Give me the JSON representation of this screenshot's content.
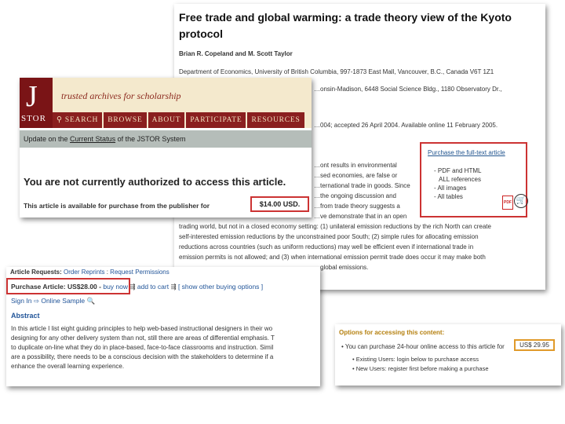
{
  "paper": {
    "title": "Free trade and global warming: a trade theory view of the Kyoto protocol",
    "authors": "Brian R. Copeland and M. Scott Taylor",
    "affil1": "Department of Economics, University of British Columbia, 997-1873 East Mall, Vancouver, B.C., Canada V6T 1Z1",
    "affil2": "…onsin-Madison, 6448 Social Science Bldg., 1180 Observatory Dr.,",
    "received": "…004; accepted 26 April 2004. Available online 11 February 2005.",
    "body": [
      "…ont results in environmental",
      "…sed economies, are false or",
      "…ternational trade in goods. Since",
      "…the ongoing discussion and",
      "…from trade theory suggests a",
      "…ve demonstrate that in an open",
      "trading world, but not in a closed economy setting: (1) unilateral emission reductions by the rich North can create",
      "self-interested emission reductions by the unconstrained poor South; (2) simple rules for allocating emission",
      "reductions across countries (such as uniform reductions) may well be efficient even if international trade in",
      "emission permits is not allowed; and (3) when international emission permit trade does occur it may make both",
      "…global emissions."
    ],
    "purchase_box": {
      "title": "Purchase the full-text article",
      "items": [
        "- PDF and HTML",
        "ALL references",
        "- All images",
        "- All tables"
      ],
      "pdf_label": "PDF",
      "cart_icon": "cart-icon"
    }
  },
  "jstor": {
    "logo_letter": "J",
    "logo_text": "STOR",
    "tagline": "trusted archives for scholarship",
    "nav": [
      "⚲ SEARCH",
      "BROWSE",
      "ABOUT",
      "PARTICIPATE",
      "RESOURCES"
    ],
    "status_prefix": "Update on the ",
    "status_link": "Current Status",
    "status_suffix": " of the JSTOR System",
    "not_authorized": "You are not currently authorized to access this article.",
    "available": "This article is available for purchase from the publisher for",
    "price": "$14.00 USD."
  },
  "article": {
    "requests_label": "Article Requests:",
    "order_reprints": "Order Reprints",
    "separator": " : ",
    "request_permissions": "Request Permissions",
    "purchase_label": "Purchase Article: US$28.00 -",
    "buy_now": "buy now",
    "add_to_cart": "add to cart",
    "other_options": "[ show other buying options ]",
    "sign_in": "Sign In",
    "online_sample": "Online Sample",
    "abstract_title": "Abstract",
    "abstract_lines": [
      "In this article I list eight guiding principles to help web-based instructional designers in their wo",
      "designing for any other delivery system than not, still there are areas of differential emphasis. T",
      "to duplicate on-line what they do in place-based, face-to-face classrooms and instruction. Simil",
      "are a possibility, there needs to be a conscious decision with the stakeholders to determine if a",
      "enhance the overall learning experience."
    ]
  },
  "options": {
    "title": "Options for accessing this content:",
    "line": "• You can purchase 24-hour online access to this article for",
    "price": "US$ 29.95",
    "sub1": "• Existing Users: login below to purchase access",
    "sub2": "• New Users: register first before making a purchase"
  }
}
